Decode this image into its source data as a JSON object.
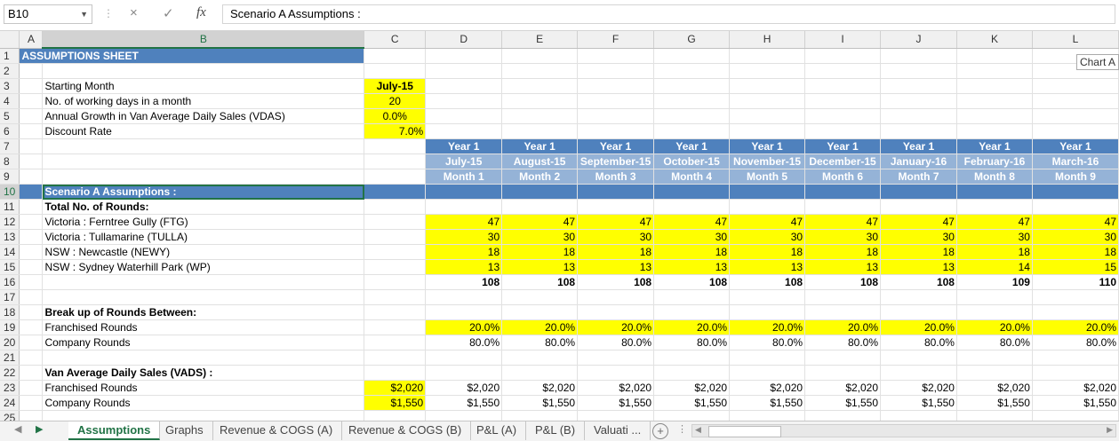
{
  "formula_bar": {
    "name_box": "B10",
    "cancel_icon": "×",
    "enter_icon": "✓",
    "fx_label": "fx",
    "formula": "Scenario A Assumptions :"
  },
  "columns": [
    "A",
    "B",
    "C",
    "D",
    "E",
    "F",
    "G",
    "H",
    "I",
    "J",
    "K",
    "L"
  ],
  "rows": [
    "1",
    "2",
    "3",
    "4",
    "5",
    "6",
    "7",
    "8",
    "9",
    "10",
    "11",
    "12",
    "13",
    "14",
    "15",
    "16",
    "17",
    "18",
    "19",
    "20",
    "21",
    "22",
    "23",
    "24",
    "25"
  ],
  "sheet": {
    "title": "ASSUMPTIONS SHEET",
    "inputs": [
      {
        "label": "Starting Month",
        "value": "July-15"
      },
      {
        "label": "No. of working days in a month",
        "value": "20"
      },
      {
        "label": "Annual Growth in Van Average Daily Sales  (VDAS)",
        "value": "0.0%"
      },
      {
        "label": "Discount Rate",
        "value": "7.0%"
      }
    ],
    "period_years": [
      "Year 1",
      "Year 1",
      "Year 1",
      "Year 1",
      "Year 1",
      "Year 1",
      "Year 1",
      "Year 1",
      "Year 1"
    ],
    "period_months": [
      "July-15",
      "August-15",
      "September-15",
      "October-15",
      "November-15",
      "December-15",
      "January-16",
      "February-16",
      "March-16"
    ],
    "period_numbers": [
      "Month 1",
      "Month 2",
      "Month 3",
      "Month 4",
      "Month 5",
      "Month 6",
      "Month 7",
      "Month 8",
      "Month 9"
    ],
    "scenario_label": "Scenario A Assumptions :",
    "rounds_heading": "Total No. of Rounds:",
    "rounds": [
      {
        "label": "Victoria : Ferntree Gully (FTG)",
        "values": [
          "47",
          "47",
          "47",
          "47",
          "47",
          "47",
          "47",
          "47",
          "47"
        ]
      },
      {
        "label": "Victoria : Tullamarine (TULLA)",
        "values": [
          "30",
          "30",
          "30",
          "30",
          "30",
          "30",
          "30",
          "30",
          "30"
        ]
      },
      {
        "label": "NSW : Newcastle (NEWY)",
        "values": [
          "18",
          "18",
          "18",
          "18",
          "18",
          "18",
          "18",
          "18",
          "18"
        ]
      },
      {
        "label": "NSW : Sydney Waterhill Park (WP)",
        "values": [
          "13",
          "13",
          "13",
          "13",
          "13",
          "13",
          "13",
          "14",
          "15"
        ]
      }
    ],
    "rounds_total": [
      "108",
      "108",
      "108",
      "108",
      "108",
      "108",
      "108",
      "109",
      "110"
    ],
    "breakup_heading": "Break up of Rounds Between:",
    "franchised_label": "Franchised Rounds",
    "franchised_values": [
      "20.0%",
      "20.0%",
      "20.0%",
      "20.0%",
      "20.0%",
      "20.0%",
      "20.0%",
      "20.0%",
      "20.0%"
    ],
    "company_label": "Company Rounds",
    "company_values": [
      "80.0%",
      "80.0%",
      "80.0%",
      "80.0%",
      "80.0%",
      "80.0%",
      "80.0%",
      "80.0%",
      "80.0%"
    ],
    "vads_heading": "Van Average Daily Sales (VADS) :",
    "vads_franchised_label": "Franchised Rounds",
    "vads_franchised_input": "$2,020",
    "vads_franchised_values": [
      "$2,020",
      "$2,020",
      "$2,020",
      "$2,020",
      "$2,020",
      "$2,020",
      "$2,020",
      "$2,020",
      "$2,020"
    ],
    "vads_company_label": "Company Rounds",
    "vads_company_input": "$1,550",
    "vads_company_values": [
      "$1,550",
      "$1,550",
      "$1,550",
      "$1,550",
      "$1,550",
      "$1,550",
      "$1,550",
      "$1,550",
      "$1,550"
    ]
  },
  "chart_tooltip": "Chart A",
  "tabs": [
    "Assumptions",
    "Graphs",
    "Revenue & COGS (A)",
    "Revenue & COGS (B)",
    "P&L (A)",
    "P&L (B)",
    "Valuati ..."
  ],
  "active_tab": "Assumptions",
  "colors": {
    "accent": "#217346",
    "header_blue": "#4f81bd",
    "light_blue": "#95b3d7",
    "input_yellow": "#ffff00"
  }
}
